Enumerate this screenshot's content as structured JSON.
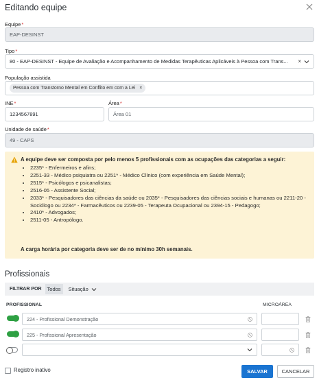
{
  "modal": {
    "title": "Editando equipe",
    "close_icon": "close-icon"
  },
  "form": {
    "equipe": {
      "label": "Equipe",
      "value": "EAP-DESINST"
    },
    "tipo": {
      "label": "Tipo",
      "value": "80 - EAP-DESINST - Equipe de Avaliação e Acompanhamento de Medidas Terapêuticas Aplicáveis à Pessoa com Trans...",
      "clear": "×"
    },
    "populacao": {
      "label": "População assistida",
      "chip": "Pessoa com Transtorno Mental em Conflito em com a Lei",
      "chip_clear": "×"
    },
    "ine": {
      "label": "INE",
      "value": "1234567891"
    },
    "area": {
      "label": "Área",
      "value": "Área 01"
    },
    "unidade": {
      "label": "Unidade de saúde",
      "value": "49 - CAPS"
    }
  },
  "warning": {
    "title": "A equipe deve ser composta por pelo menos 5 profissionais com as ocupações das categorias a seguir:",
    "items": [
      "2235* - Enfermeiros e afins;",
      "2251-33 - Médico psiquiatra ou 2251* - Médico Clínico (com experiência em Saúde Mental);",
      "2515* - Psicólogos e psicanalistas;",
      "2516-05 - Assistente Social;",
      "2033* - Pesquisadores das ciências da saúde ou 2035* - Pesquisadores das ciências sociais e humanas ou 2211-20 - Sociólogo ou 2234* - Farmacêuticos ou 2239-05 - Terapeuta Ocupacional ou 2394-15 - Pedagogo;",
      "2410* - Advogados;",
      "2511-05 - Antropólogo."
    ],
    "footer": "A carga horária por categoria deve ser de no mínimo 30h semanais.",
    "color": "#fdf3d6"
  },
  "profissionais": {
    "title": "Profissionais",
    "filter_label": "FILTRAR POR",
    "filter_todos": "Todos",
    "filter_situacao": "Situação",
    "col_profissional": "PROFISSIONAL",
    "col_microarea": "MICROÁREA",
    "rows": [
      {
        "active": true,
        "name": "224 - Profissional Demonstração",
        "microarea": ""
      },
      {
        "active": true,
        "name": "225 - Profissional Apresentação",
        "microarea": ""
      },
      {
        "active": false,
        "name": "",
        "microarea": ""
      }
    ]
  },
  "footer": {
    "registro_inativo": "Registro inativo",
    "save": "SALVAR",
    "cancel": "CANCELAR",
    "accent": "#1a74d1",
    "toggle_on_color": "#2ea043"
  }
}
